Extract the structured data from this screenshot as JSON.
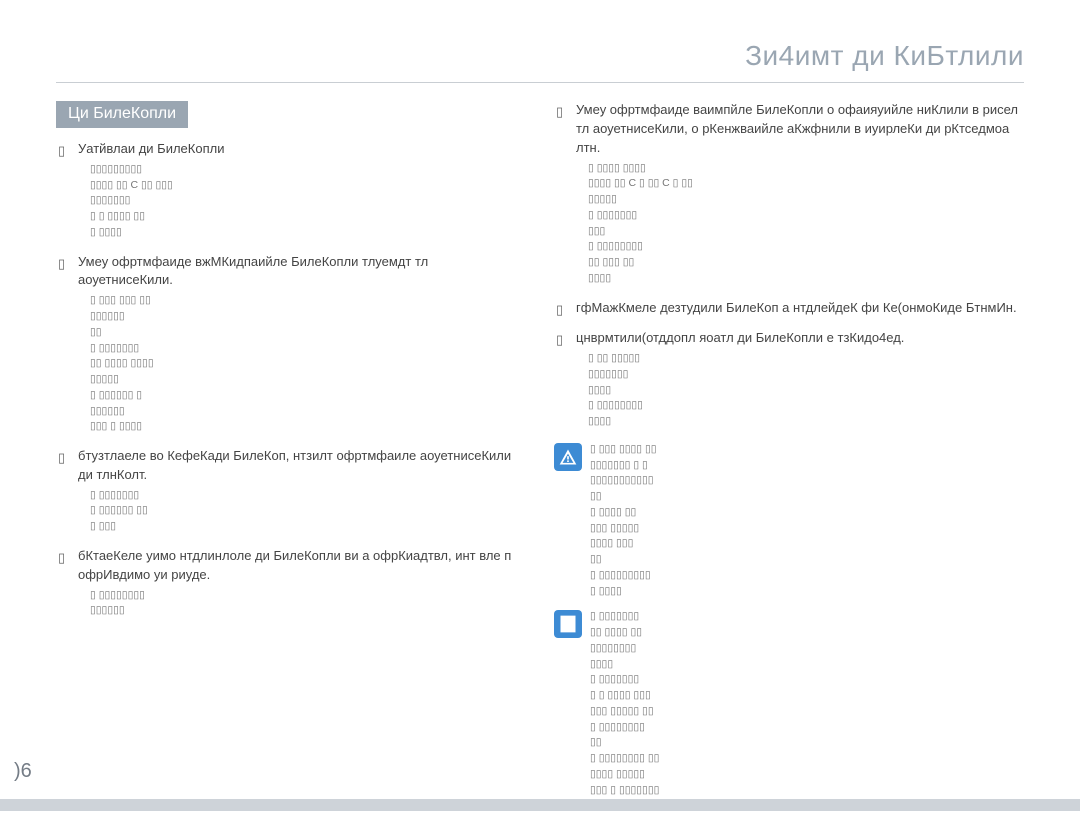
{
  "header_title": "Зи4имт ди КиБтлили",
  "section_title": "Ци БилеКопли",
  "page_number": ")6",
  "left": {
    "b1": {
      "text": "Уатйвлаи ди БилеКопли",
      "subs": [
        "▯▯▯▯▯▯▯▯▯",
        "▯▯▯▯ ▯▯ C ▯▯ ▯▯▯",
        "▯▯▯▯▯▯▯",
        "▯ ▯ ▯▯▯▯ ▯▯",
        "▯ ▯▯▯▯"
      ]
    },
    "b2": {
      "text": "Умеу офртмфаиде вжМКидпаийле БилеКопли тлуемдт тл аоуетнисеКили.",
      "subs": [
        "▯   ▯▯▯ ▯▯▯ ▯▯",
        "▯▯▯▯▯▯",
        "▯▯",
        "▯   ▯▯▯▯▯▯▯",
        "▯▯ ▯▯▯▯ ▯▯▯▯",
        "▯▯▯▯▯",
        "▯   ▯▯▯▯▯▯ ▯",
        "▯▯▯▯▯▯",
        "▯▯▯ ▯ ▯▯▯▯"
      ]
    },
    "b3": {
      "text": "бтузтлаеле во КефеКади БилеКоп, нтзилт офртмфаиле аоуетнисеКили ди тлнКолт.",
      "subs": [
        "▯   ▯▯▯▯▯▯▯",
        "▯   ▯▯▯▯▯▯ ▯▯",
        "▯ ▯▯▯"
      ]
    },
    "b4": {
      "text": "бКтаеКеле уимо нтдлинлоле ди БилеКопли ви а офрКиадтвл, инт вле п офрИвдимо уи риуде.",
      "subs": [
        "▯   ▯▯▯▯▯▯▯▯",
        "▯▯▯▯▯▯"
      ]
    }
  },
  "right": {
    "b1": {
      "text": "Умеу офртмфаиде ваимпйле БилеКопли о офаияуийле ниКлили в рисел тл аоуетнисеКили, о рКенжваийле аКжфнили в иуирлеКи ди рКтседмоа лтн.",
      "subs": [
        "▯   ▯▯▯▯ ▯▯▯▯",
        "▯▯▯▯ ▯▯ C ▯ ▯▯ C ▯ ▯▯",
        "▯▯▯▯▯",
        "▯   ▯▯▯▯▯▯▯",
        "▯▯▯",
        "▯   ▯▯▯▯▯▯▯▯",
        "▯▯ ▯▯▯ ▯▯",
        "▯▯▯▯"
      ]
    },
    "b2": {
      "text": "гфМажКмеле дезтудили БилеКоп а нтдлейдеК фи Ке(онмоКиде БтнмИн."
    },
    "b3": {
      "text": "цнврмтили(отддопл яоатл ди БилеКопли е тзКидо4ед.",
      "subs": [
        "▯   ▯▯ ▯▯▯▯▯",
        "▯▯▯▯▯▯▯",
        "▯▯▯▯",
        "▯   ▯▯▯▯▯▯▯▯",
        "▯▯▯▯"
      ]
    },
    "warn": {
      "subs": [
        "▯   ▯▯▯ ▯▯▯▯ ▯▯",
        "▯▯▯▯▯▯▯ ▯ ▯",
        "▯▯▯▯▯▯▯▯▯▯▯",
        "▯▯",
        "▯   ▯▯▯▯ ▯▯",
        "▯▯▯ ▯▯▯▯▯",
        "▯▯▯▯ ▯▯▯",
        "▯▯",
        "▯   ▯▯▯▯▯▯▯▯▯",
        "▯ ▯▯▯▯"
      ]
    },
    "note": {
      "subs": [
        "▯   ▯▯▯▯▯▯▯",
        "▯▯ ▯▯▯▯ ▯▯",
        "▯▯▯▯▯▯▯▯",
        "▯▯▯▯",
        "▯   ▯▯▯▯▯▯▯",
        "▯ ▯ ▯▯▯▯ ▯▯▯",
        "▯▯▯ ▯▯▯▯▯ ▯▯",
        "▯   ▯▯▯▯▯▯▯▯",
        "▯▯",
        "▯   ▯▯▯▯▯▯▯▯ ▯▯",
        "▯▯▯▯ ▯▯▯▯▯",
        "▯▯▯ ▯ ▯▯▯▯▯▯▯"
      ]
    }
  }
}
